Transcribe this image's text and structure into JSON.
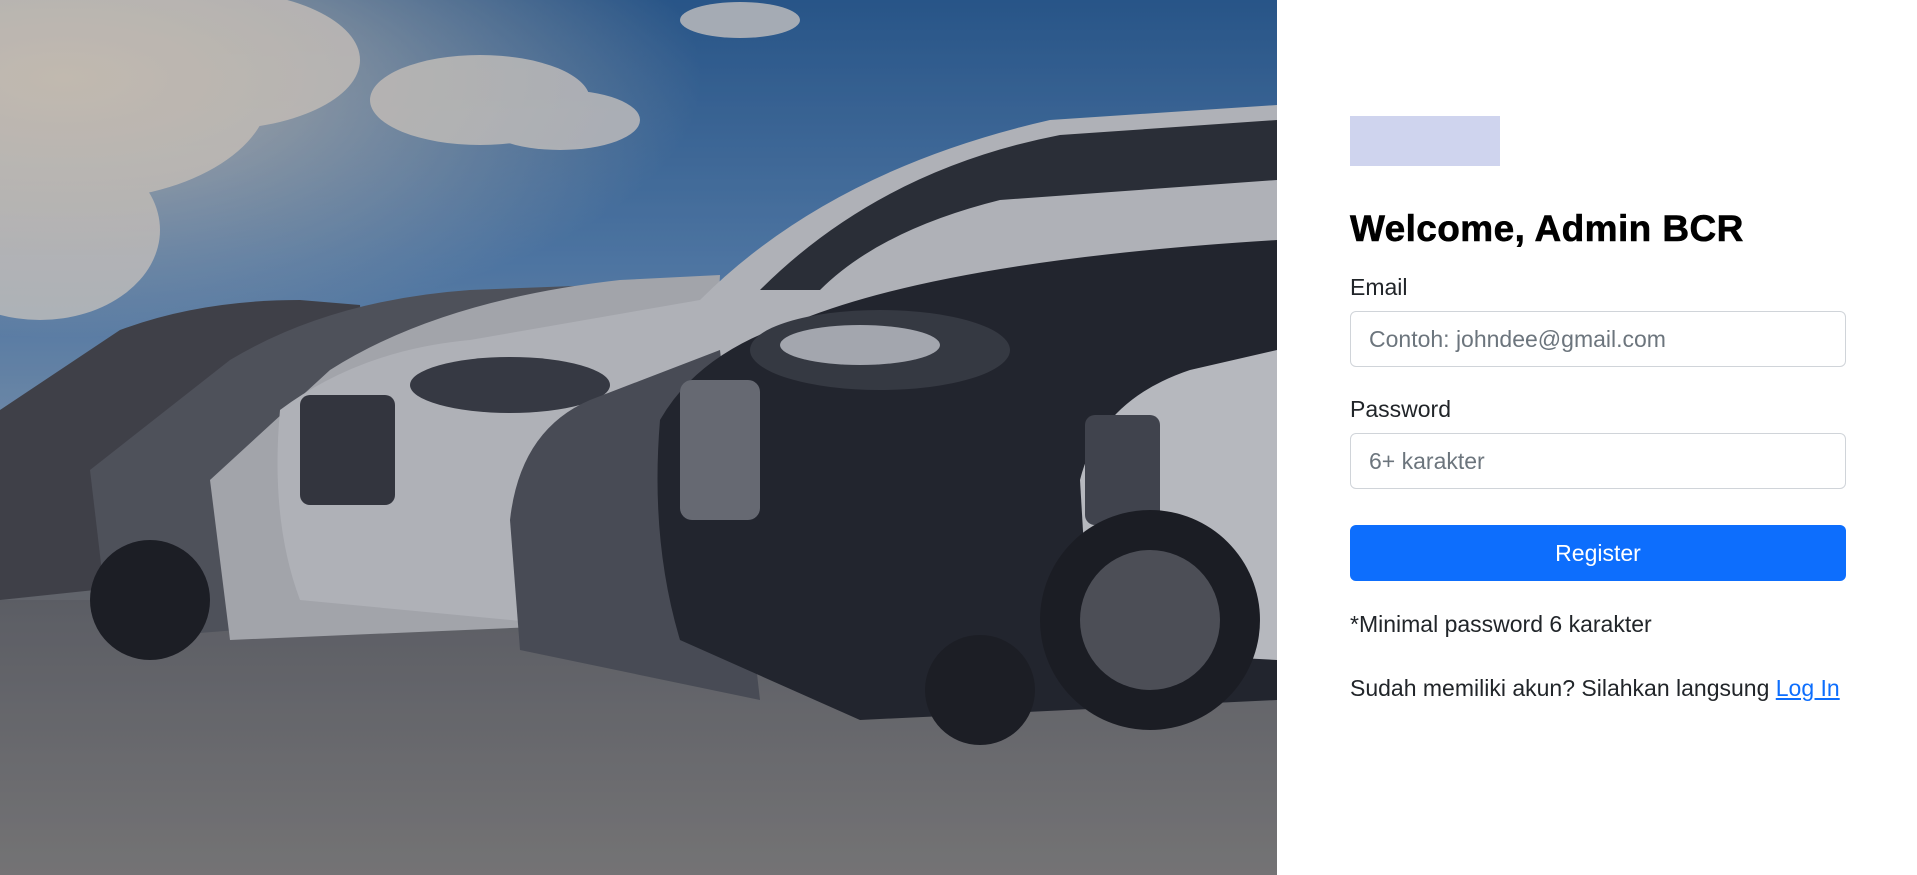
{
  "hero": {
    "image": "car-lot-photo",
    "overlay_color": "#1a1f33"
  },
  "logo": {
    "placeholder_color": "#cfd4ee"
  },
  "form": {
    "title": "Welcome, Admin BCR",
    "email": {
      "label": "Email",
      "value": "",
      "placeholder": "Contoh: johndee@gmail.com"
    },
    "password": {
      "label": "Password",
      "value": "",
      "placeholder": "6+ karakter"
    },
    "submit_label": "Register",
    "hint": "*Minimal password 6 karakter",
    "login_prompt": "Sudah memiliki akun? Silahkan langsung ",
    "login_link": "Log In"
  },
  "colors": {
    "primary": "#0d6efd",
    "text": "#212529",
    "placeholder": "#6c757d",
    "border": "#d0d4d9"
  }
}
